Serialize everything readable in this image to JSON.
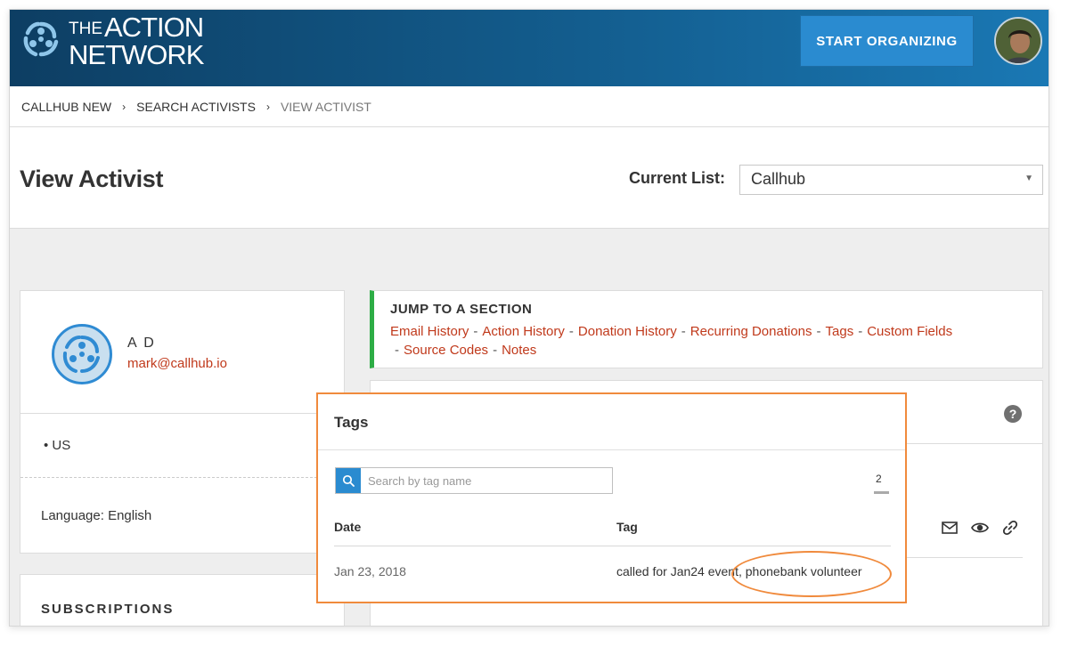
{
  "header": {
    "logo_line1_small": "THE",
    "logo_line1": "ACTION",
    "logo_line2": "NETWORK",
    "start_button": "START ORGANIZING"
  },
  "breadcrumb": {
    "items": [
      "CALLHUB NEW",
      "SEARCH ACTIVISTS",
      "VIEW ACTIVIST"
    ],
    "separator": "›"
  },
  "page": {
    "title": "View Activist",
    "current_list_label": "Current List:",
    "current_list_value": "Callhub"
  },
  "profile": {
    "name": "A D",
    "email": "mark@callhub.io",
    "country": "• US",
    "language": "Language: English"
  },
  "subscriptions": {
    "title": "SUBSCRIPTIONS"
  },
  "jump": {
    "title": "JUMP TO A SECTION",
    "links": [
      "Email History",
      "Action History",
      "Donation History",
      "Recurring Donations",
      "Tags",
      "Custom Fields",
      "Source Codes",
      "Notes"
    ],
    "dash": "-"
  },
  "help_glyph": "?",
  "tags": {
    "title": "Tags",
    "search_placeholder": "Search by tag name",
    "count": "2",
    "columns": {
      "date": "Date",
      "tag": "Tag"
    },
    "rows": [
      {
        "date": "Jan 23, 2018",
        "tag": "called for Jan24 event, phonebank volunteer"
      }
    ]
  },
  "colors": {
    "header_dark": "#0d3e63",
    "header_light": "#1a78b4",
    "button_blue": "#2a8bd0",
    "link_red": "#c0391b",
    "accent_green": "#2dad45",
    "highlight_orange": "#f08a3c"
  },
  "icons": [
    "logo-icon",
    "user-avatar",
    "help-icon",
    "envelope-icon",
    "eye-icon",
    "link-icon",
    "search-icon",
    "chevron-down-icon"
  ]
}
